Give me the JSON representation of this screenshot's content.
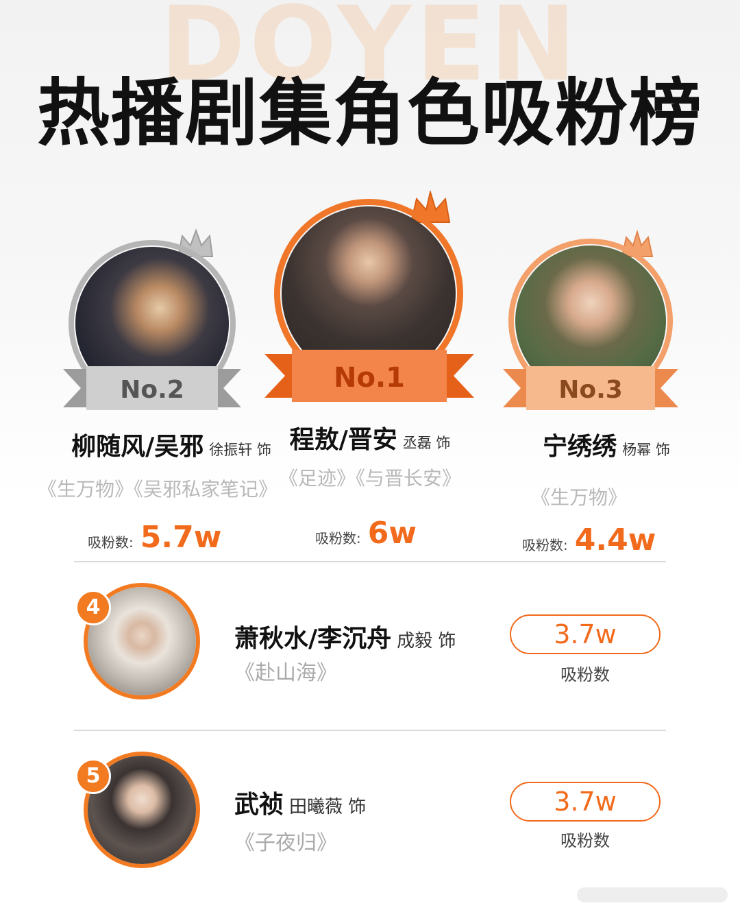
{
  "header": {
    "watermark": "DOYEN",
    "title": "热播剧集角色吸粉榜"
  },
  "podium": [
    {
      "rank_label": "No.2",
      "role": "柳随风/吴邪",
      "actor": "徐振轩 饰",
      "works": "《生万物》《吴邪私家笔记》",
      "fans_label": "吸粉数:",
      "fans_value": "5.7w",
      "ring_color": "#b5b5b5"
    },
    {
      "rank_label": "No.1",
      "role": "程敖/晋安",
      "actor": "丞磊 饰",
      "works": "《足迹》《与晋长安》",
      "fans_label": "吸粉数:",
      "fans_value": "6w",
      "ring_color": "#f0772a"
    },
    {
      "rank_label": "No.3",
      "role": "宁绣绣",
      "actor": "杨幂 饰",
      "works": "《生万物》",
      "fans_label": "吸粉数:",
      "fans_value": "4.4w",
      "ring_color": "#f3a06a"
    }
  ],
  "list": [
    {
      "rank": "4",
      "role": "萧秋水/李沉舟",
      "actor": "成毅 饰",
      "work": "《赴山海》",
      "fans_value": "3.7w",
      "fans_label": "吸粉数"
    },
    {
      "rank": "5",
      "role": "武祯",
      "actor": "田曦薇 饰",
      "work": "《子夜归》",
      "fans_value": "3.7w",
      "fans_label": "吸粉数"
    }
  ],
  "colors": {
    "accent": "#f26a1b",
    "silver": "#b5b5b5",
    "bronze": "#f3a06a"
  }
}
